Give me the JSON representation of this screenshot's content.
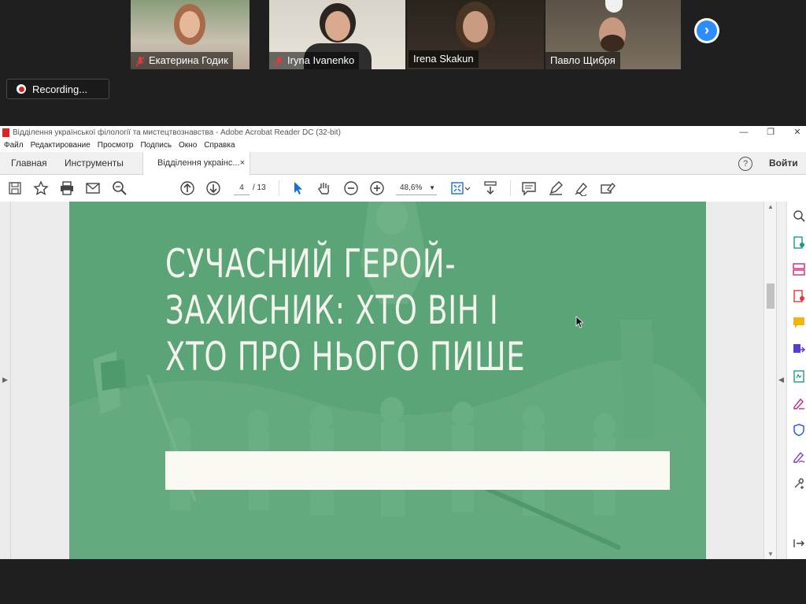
{
  "participants": [
    {
      "name": "Екатерина Годик",
      "muted": true,
      "active": false
    },
    {
      "name": "Iryna Ivanenko",
      "muted": true,
      "active": false
    },
    {
      "name": "Irena Skakun",
      "muted": false,
      "active": true
    },
    {
      "name": "Павло Щибря",
      "muted": false,
      "active": false
    }
  ],
  "recording": {
    "label": "Recording..."
  },
  "acrobat": {
    "window_title": "Відділення української філології та мистецтвознавства - Adobe Acrobat Reader DC (32-bit)",
    "menu": [
      "Файл",
      "Редактирование",
      "Просмотр",
      "Подпись",
      "Окно",
      "Справка"
    ],
    "tabs": {
      "home": "Главная",
      "tools": "Инструменты",
      "document": "Відділення украінс...",
      "close": "×"
    },
    "login": "Войти",
    "help": "?",
    "page_current": "4",
    "page_total": "/ 13",
    "zoom": "48,6%"
  },
  "slide": {
    "title_lines": [
      "СУЧАСНИЙ ГЕРОЙ-",
      "ЗАХИСНИК: ХТО ВІН І",
      "ХТО ПРО НЬОГО ПИШЕ"
    ],
    "bg_color": "#5aa477",
    "box_color": "#fafaf3"
  },
  "colors": {
    "zoom_accent": "#2d8cff",
    "active_tile": "#9ccf4a",
    "recording_dot": "#e02020"
  }
}
